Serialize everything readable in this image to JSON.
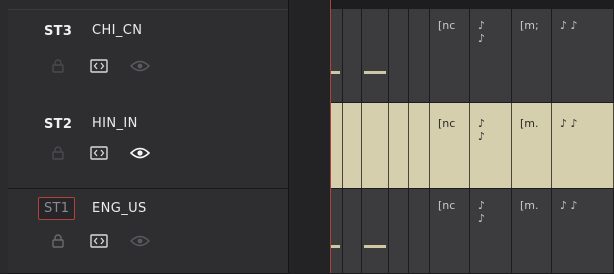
{
  "tracks": [
    {
      "id": "ST3",
      "name": "CHI_CN",
      "selected": false,
      "visible": false
    },
    {
      "id": "ST2",
      "name": "HIN_IN",
      "selected": false,
      "visible": true
    },
    {
      "id": "ST1",
      "name": "ENG_US",
      "selected": true,
      "visible": false
    }
  ],
  "clips": {
    "st3": [
      "[nc",
      "♪\n♪",
      "[m;",
      "♪ ♪"
    ],
    "st2": [
      "[nc",
      "♪\n♪",
      "[m.",
      "♪ ♪"
    ],
    "st1": [
      "[nc",
      "♪\n♪",
      "[m.",
      "♪ ♪"
    ]
  },
  "icons": {
    "lock": "lock-icon",
    "subtitle": "subtitle-icon",
    "eye": "eye-icon"
  },
  "colors": {
    "playhead": "#a8443c",
    "selected_clip": "#d6cfae",
    "clip": "#3c3c3f",
    "selection_border": "#b2413c"
  }
}
